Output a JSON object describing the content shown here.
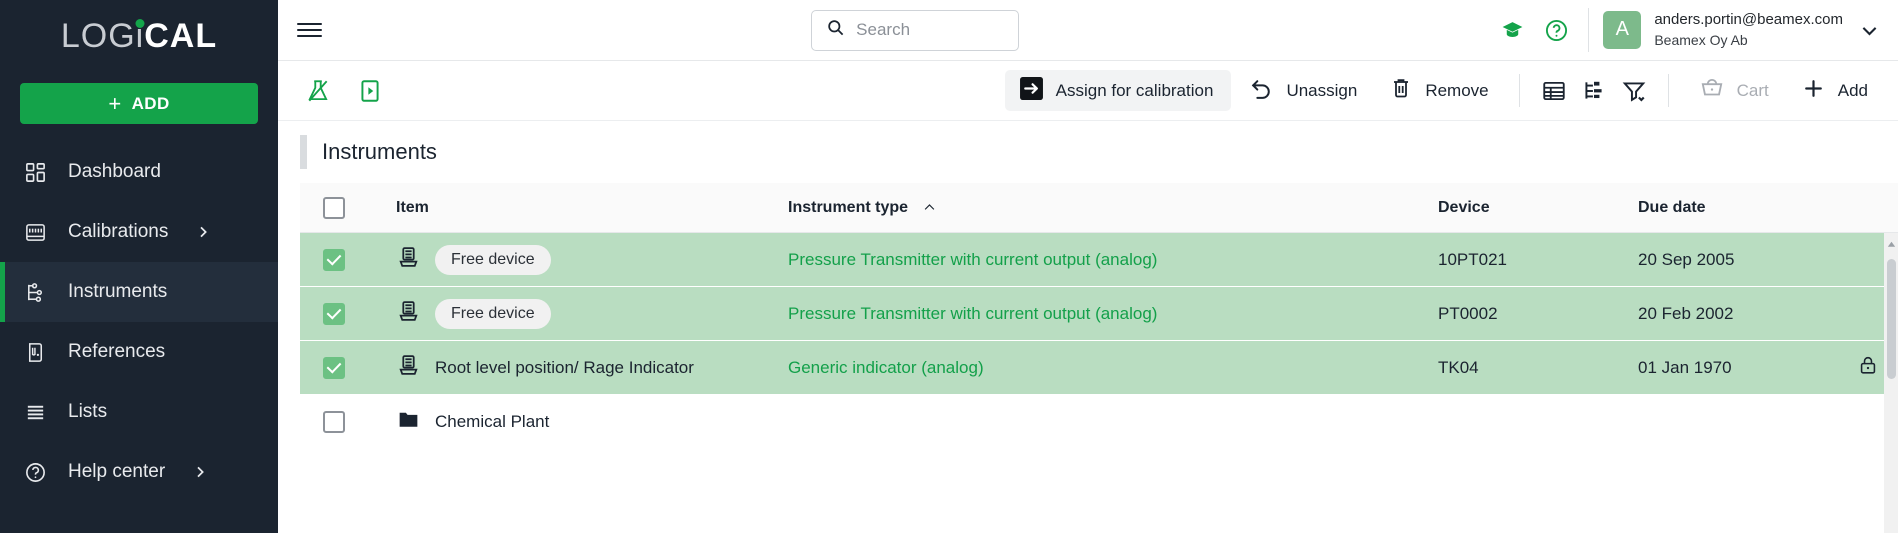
{
  "brand": {
    "logo_part1": "LOG",
    "logo_i": "i",
    "logo_part2": "CAL",
    "accent_green": "#14a34a"
  },
  "sidebar": {
    "add_button_label": "ADD",
    "add_button_plus": "+",
    "items": [
      {
        "label": "Dashboard",
        "icon": "dashboard-icon",
        "active": false,
        "has_chevron": false
      },
      {
        "label": "Calibrations",
        "icon": "calibrations-icon",
        "active": false,
        "has_chevron": true
      },
      {
        "label": "Instruments",
        "icon": "instruments-icon",
        "active": true,
        "has_chevron": false
      },
      {
        "label": "References",
        "icon": "references-icon",
        "active": false,
        "has_chevron": false
      },
      {
        "label": "Lists",
        "icon": "lists-icon",
        "active": false,
        "has_chevron": false
      },
      {
        "label": "Help center",
        "icon": "help-icon",
        "active": false,
        "has_chevron": true
      }
    ]
  },
  "topbar": {
    "search_placeholder": "Search",
    "search_value": "",
    "icons": [
      {
        "name": "graduation-cap-icon",
        "color": "#14a34a"
      },
      {
        "name": "help-circle-icon",
        "color": "#14a34a"
      }
    ],
    "user": {
      "avatar_initial": "A",
      "email": "anders.portin@beamex.com",
      "organization": "Beamex Oy Ab"
    }
  },
  "actionbar": {
    "left_icons": [
      {
        "name": "no-test-flask-icon",
        "color": "#14a34a"
      },
      {
        "name": "run-play-box-icon",
        "color": "#14a34a"
      }
    ],
    "assign_label": "Assign for calibration",
    "unassign_label": "Unassign",
    "remove_label": "Remove",
    "right_icons": [
      {
        "name": "table-view-icon"
      },
      {
        "name": "hierarchy-view-icon"
      },
      {
        "name": "filter-icon"
      }
    ],
    "cart_label": "Cart",
    "cart_disabled": true,
    "add_label": "Add"
  },
  "page": {
    "title": "Instruments"
  },
  "table": {
    "columns": {
      "item": "Item",
      "instrument_type": "Instrument type",
      "device": "Device",
      "due_date": "Due date"
    },
    "sort_column": "instrument_type",
    "sort_direction": "asc",
    "header_checkbox_checked": false,
    "rows": [
      {
        "selected": true,
        "icon": "instrument-icon",
        "item_pill": "Free device",
        "item_text": "",
        "instrument_type": "Pressure Transmitter with current output (analog)",
        "device": "10PT021",
        "due_date": "20 Sep 2005",
        "locked": false
      },
      {
        "selected": true,
        "icon": "instrument-icon",
        "item_pill": "Free device",
        "item_text": "",
        "instrument_type": "Pressure Transmitter with current output (analog)",
        "device": "PT0002",
        "due_date": "20 Feb 2002",
        "locked": false
      },
      {
        "selected": true,
        "icon": "instrument-icon",
        "item_pill": "",
        "item_text": "Root level position/ Rage Indicator",
        "instrument_type": "Generic indicator (analog)",
        "device": "TK04",
        "due_date": "01 Jan 1970",
        "locked": true
      },
      {
        "selected": false,
        "icon": "folder-icon",
        "item_pill": "",
        "item_text": "Chemical Plant",
        "instrument_type": "",
        "device": "",
        "due_date": "",
        "locked": false
      }
    ]
  }
}
